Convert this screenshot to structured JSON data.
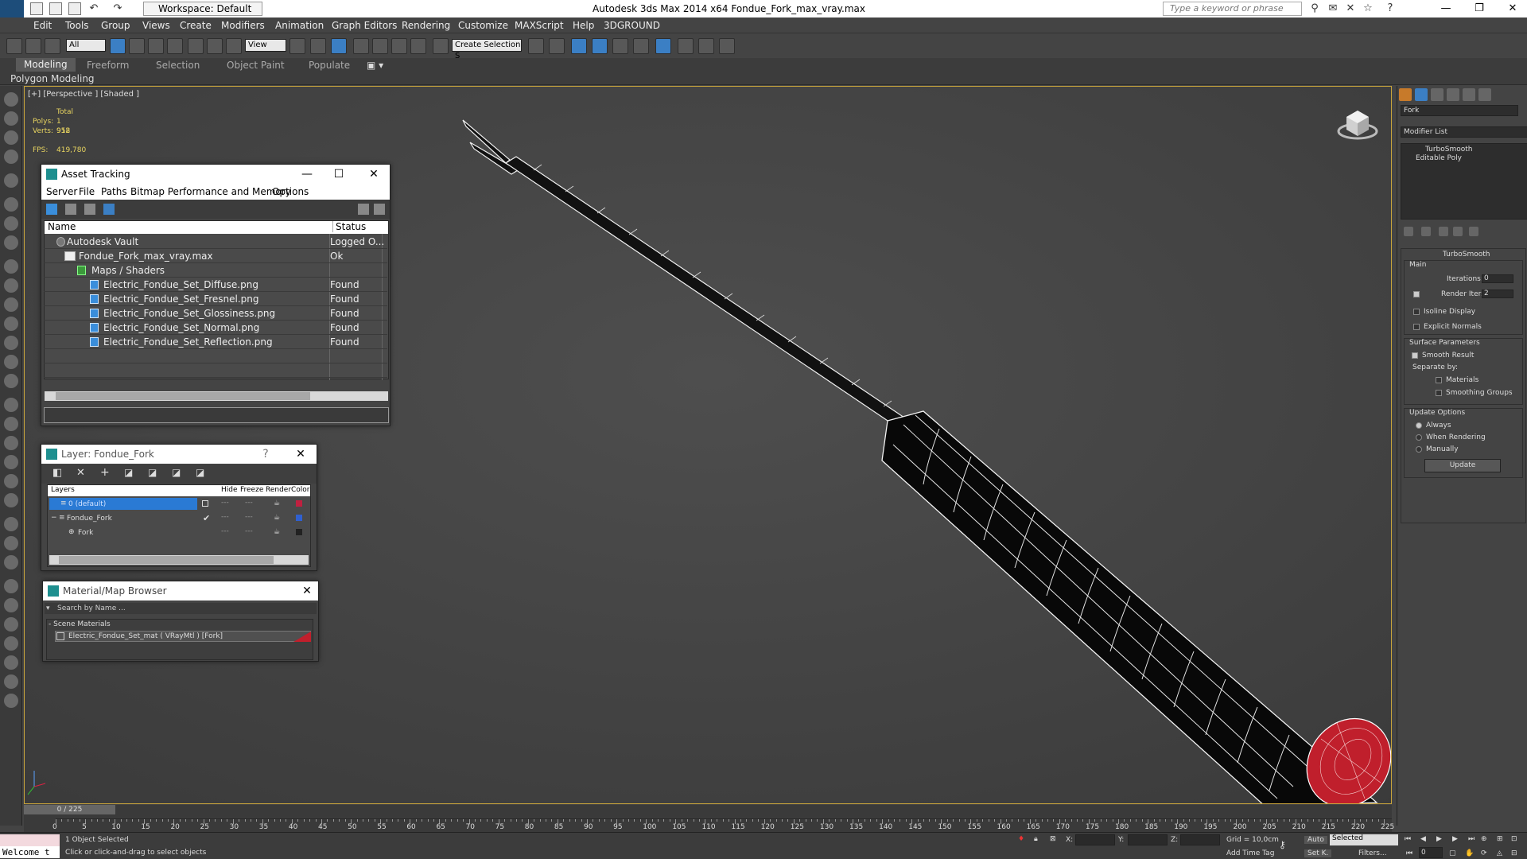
{
  "app": {
    "workspace": "Workspace: Default",
    "title": "Autodesk 3ds Max  2014 x64      Fondue_Fork_max_vray.max",
    "search_placeholder": "Type a keyword or phrase"
  },
  "menu": [
    "Edit",
    "Tools",
    "Group",
    "Views",
    "Create",
    "Modifiers",
    "Animation",
    "Graph Editors",
    "Rendering",
    "Customize",
    "MAXScript",
    "Help",
    "3DGROUND"
  ],
  "toolbar": {
    "filter": "All",
    "refcoord": "View",
    "selset": "Create Selection S"
  },
  "ribbon": {
    "tabs": [
      "Modeling",
      "Freeform",
      "Selection",
      "Object Paint",
      "Populate"
    ],
    "sub": "Polygon Modeling"
  },
  "viewport": {
    "label": "[+] [Perspective ] [Shaded ]",
    "stats": {
      "total": "Total",
      "polys_label": "Polys:",
      "polys": "1 912",
      "verts_label": "Verts:",
      "verts": "958",
      "fps_label": "FPS:",
      "fps": "419,780"
    }
  },
  "asset_tracking": {
    "title": "Asset Tracking",
    "menu": [
      "Server",
      "File",
      "Paths",
      "Bitmap Performance and Memory",
      "Options"
    ],
    "columns": {
      "name": "Name",
      "status": "Status"
    },
    "rows": [
      {
        "name": "Autodesk Vault",
        "status": "Logged O..."
      },
      {
        "name": "Fondue_Fork_max_vray.max",
        "status": "Ok"
      },
      {
        "name": "Maps / Shaders",
        "status": ""
      },
      {
        "name": "Electric_Fondue_Set_Diffuse.png",
        "status": "Found"
      },
      {
        "name": "Electric_Fondue_Set_Fresnel.png",
        "status": "Found"
      },
      {
        "name": "Electric_Fondue_Set_Glossiness.png",
        "status": "Found"
      },
      {
        "name": "Electric_Fondue_Set_Normal.png",
        "status": "Found"
      },
      {
        "name": "Electric_Fondue_Set_Reflection.png",
        "status": "Found"
      }
    ]
  },
  "layer": {
    "title": "Layer: Fondue_Fork",
    "help": "?",
    "columns": [
      "Layers",
      "Hide",
      "Freeze",
      "Render",
      "Color"
    ],
    "rows": [
      {
        "name": "0 (default)",
        "color": "#c02040"
      },
      {
        "name": "Fondue_Fork",
        "color": "#3060d0"
      },
      {
        "name": "Fork",
        "color": "#222222"
      }
    ]
  },
  "material_browser": {
    "title": "Material/Map Browser",
    "search": "Search by Name ...",
    "group": "- Scene Materials",
    "item": "Electric_Fondue_Set_mat  ( VRayMtl ) [Fork]"
  },
  "command_panel": {
    "object_name": "Fork",
    "modifier_list": "Modifier List",
    "stack": [
      "TurboSmooth",
      "Editable Poly"
    ],
    "rollout": "TurboSmooth",
    "main": "Main",
    "iterations_label": "Iterations:",
    "iterations": "0",
    "render_iters_label": "Render Iters:",
    "render_iters": "2",
    "isoline": "Isoline Display",
    "explicit": "Explicit Normals",
    "surface": "Surface Parameters",
    "smooth": "Smooth Result",
    "separate": "Separate by:",
    "materials": "Materials",
    "smoothing": "Smoothing Groups",
    "update_opts": "Update Options",
    "always": "Always",
    "when_rendering": "When Rendering",
    "manually": "Manually",
    "update": "Update"
  },
  "timeline": {
    "frame": "0 / 225",
    "ticks": [
      "0",
      "5",
      "10",
      "15",
      "20",
      "25",
      "30",
      "35",
      "40",
      "45",
      "50",
      "55",
      "60",
      "65",
      "70",
      "75",
      "80",
      "85",
      "90",
      "95",
      "100",
      "105",
      "110",
      "115",
      "120",
      "125",
      "130",
      "135",
      "140",
      "145",
      "150",
      "155",
      "160",
      "165",
      "170",
      "175",
      "180",
      "185",
      "190",
      "195",
      "200",
      "205",
      "210",
      "215",
      "220",
      "225"
    ]
  },
  "status": {
    "script": "Welcome t",
    "selected": "1 Object Selected",
    "hint": "Click or click-and-drag to select objects",
    "x": "X:",
    "y": "Y:",
    "z": "Z:",
    "grid": "Grid = 10,0cm",
    "auto": "Auto",
    "selected_dd": "Selected",
    "setk": "Set K.",
    "filters": "Filters...",
    "add_time_tag": "Add Time Tag",
    "frame": "0"
  },
  "colors": {
    "accent": "#3b7fc4",
    "viewport_border": "#c8a43b",
    "fork_tip": "#c01f2c"
  }
}
